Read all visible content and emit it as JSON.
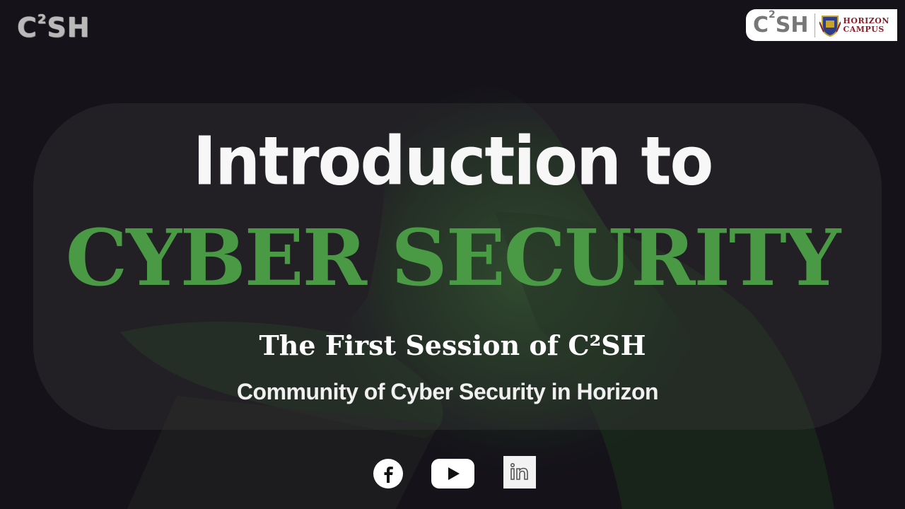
{
  "brand": {
    "logo_left_text": "C",
    "logo_left_sup": "2",
    "logo_left_tail": "SH",
    "logo_right_text": "C",
    "logo_right_sup": "2",
    "logo_right_tail": "SH",
    "campus_line1": "HORIZON",
    "campus_line2": "CAMPUS"
  },
  "slide": {
    "title_line1": "Introduction to",
    "title_line2": "CYBER SECURITY",
    "subtitle": "The First Session of  C²SH",
    "tagline": "Community of Cyber Security in Horizon"
  },
  "social": {
    "facebook_icon": "facebook-icon",
    "youtube_icon": "youtube-icon",
    "linkedin_icon": "linkedin-icon"
  },
  "colors": {
    "background": "#15121a",
    "accent_green": "#4a9a45",
    "title_white": "#f7f7f7",
    "campus_red": "#8a1f2a"
  }
}
